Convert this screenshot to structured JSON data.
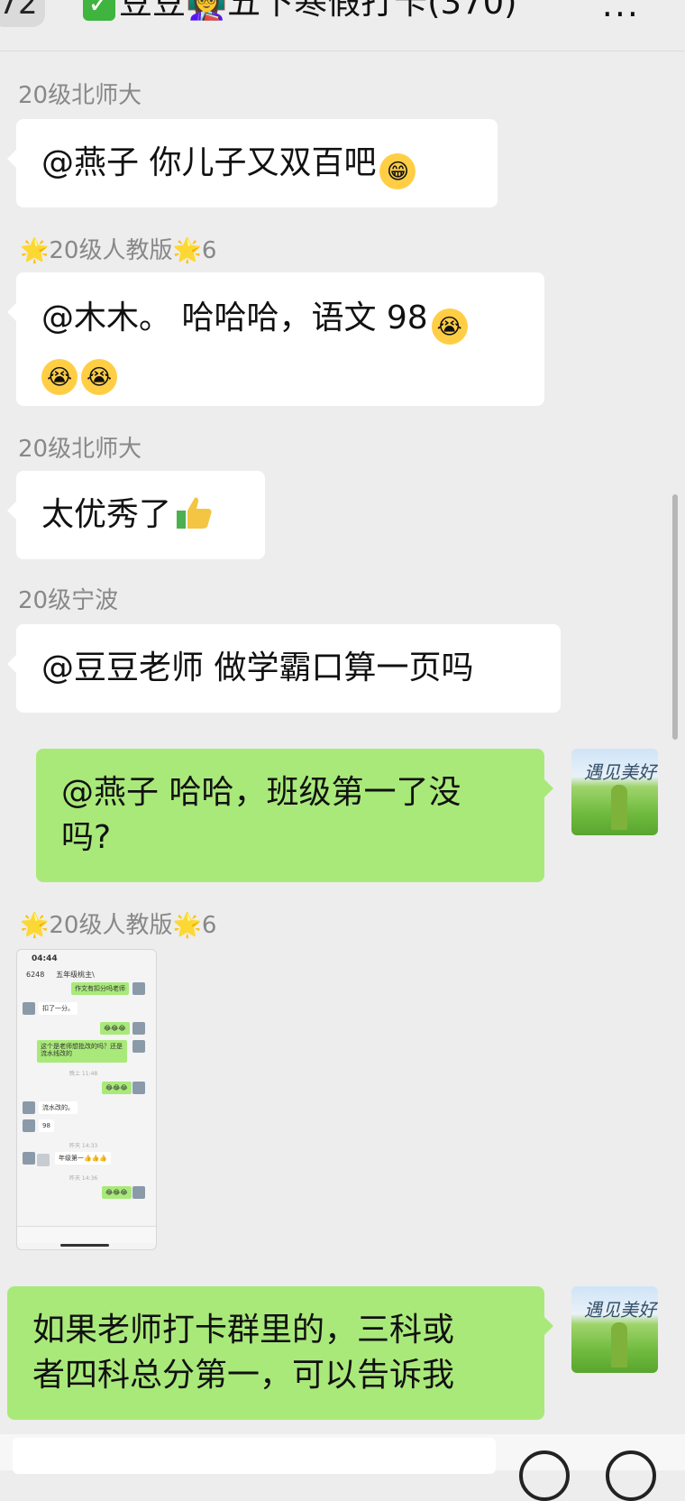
{
  "header": {
    "back_count": "72",
    "title": "豆豆👩‍🏫五下寒假打卡(370)",
    "check_icon": "check-icon",
    "more_label": "···"
  },
  "messages": [
    {
      "sender": "20级北师大",
      "text": "@燕子 你儿子又双百吧",
      "emoji": "grin-emoji"
    },
    {
      "sender_star_left": "🌟",
      "sender": "20级人教版",
      "sender_star_right": "🌟",
      "sender_suffix": "6",
      "text_line1": "@木木。 哈哈哈，语文 98",
      "emoji": "laugh-cry-emoji"
    },
    {
      "sender": "20级北师大",
      "text": "太优秀了",
      "emoji": "thumbs-up-emoji"
    },
    {
      "sender": "20级宁波",
      "text": "@豆豆老师 做学霸口算一页吗"
    },
    {
      "self": true,
      "text_line1": "@燕子 哈哈，班级第一了没",
      "text_line2": "吗?"
    },
    {
      "sender_star_left": "🌟",
      "sender": "20级人教版",
      "sender_star_right": "🌟",
      "sender_suffix": "6",
      "image": "chat-screenshot"
    },
    {
      "self": true,
      "text_line1": "如果老师打卡群里的，三科或",
      "text_line2": "者四科总分第一，可以告诉我"
    }
  ],
  "screenshot": {
    "time": "04:44",
    "title": "五年级桃主\\",
    "back_count": "6248",
    "rows": [
      "作文有扣分吗老师",
      "扣了一分。",
      "😂😂😂",
      "这个是老师想批改的吗？还是流水线改的",
      "晚上 11:48",
      "😂😂😂",
      "流水改的。",
      "98",
      "昨天 14:33",
      "年级第一👍👍👍",
      "昨天 14:36",
      "😂😂😂"
    ]
  },
  "avatar_caption": "遇见美好"
}
